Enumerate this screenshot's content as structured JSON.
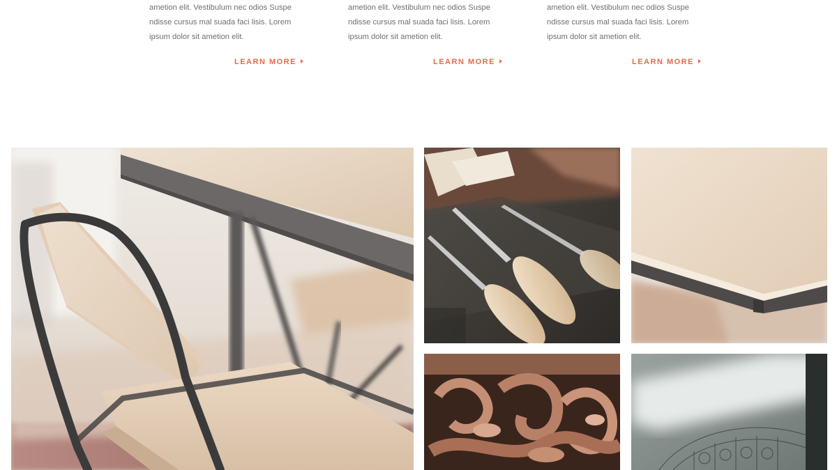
{
  "features": [
    {
      "text_lines": [
        "ametion elit. Vestibulum nec odios Suspe",
        "ndisse cursus mal suada faci lisis. Lorem",
        "ipsum dolor sit ametion elit."
      ],
      "link_label": "LEARN MORE"
    },
    {
      "text_lines": [
        "ametion elit. Vestibulum nec odios Suspe",
        "ndisse cursus mal suada faci lisis. Lorem",
        "ipsum dolor sit ametion elit."
      ],
      "link_label": "LEARN MORE"
    },
    {
      "text_lines": [
        "ametion elit. Vestibulum nec odios Suspe",
        "ndisse cursus mal suada faci lisis. Lorem",
        "ipsum dolor sit ametion elit."
      ],
      "link_label": "LEARN MORE"
    }
  ],
  "colors": {
    "accent": "#e8694a",
    "body_text": "#6f6f6f",
    "background": "#ffffff"
  },
  "gallery": {
    "images": [
      "chair-and-table-photo",
      "carving-chisels-photo",
      "table-corner-photo",
      "wood-carving-ornament-photo",
      "architectural-sketch-photo"
    ]
  }
}
